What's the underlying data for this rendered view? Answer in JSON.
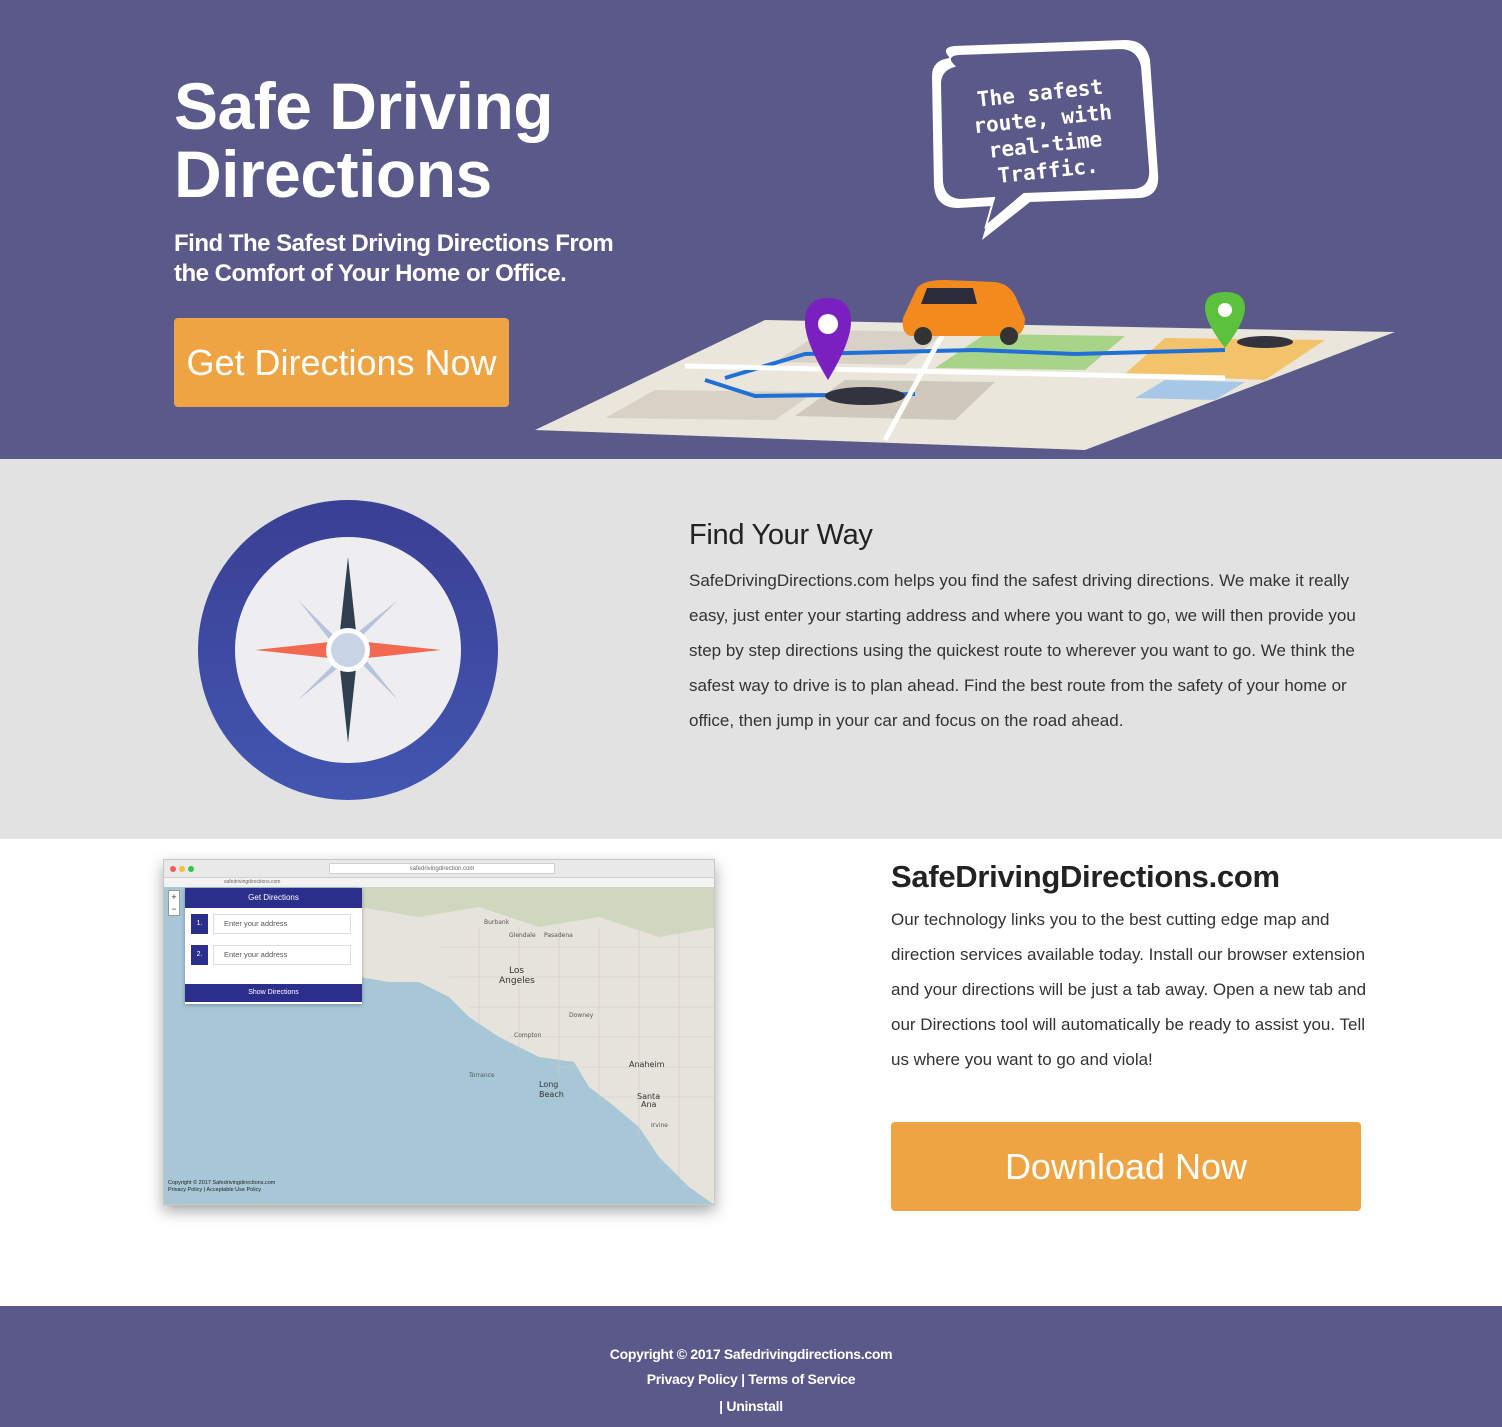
{
  "hero": {
    "title": "Safe Driving Directions",
    "subtitle": "Find The Safest Driving Directions From the Comfort of Your Home or Office.",
    "cta_label": "Get Directions Now",
    "bubble_text": "The safest route, with real-time Traffic."
  },
  "find_way": {
    "title": "Find Your Way",
    "body": "SafeDrivingDirections.com helps you find the safest driving directions. We make it really easy, just enter your starting address and where you want to go, we will then provide you step by step directions using the quickest route to wherever you want to go. We think the safest way to drive is to plan ahead. Find the best route from the safety of your home or office, then jump in your car and focus on the road ahead."
  },
  "product": {
    "title": "SafeDrivingDirections.com",
    "body": "Our technology links you to the best cutting edge map and direction services available today. Install our browser extension and your directions will be just a tab away. Open a new tab and our Directions tool will automatically be ready to assist you. Tell us where you want to go and viola!",
    "download_label": "Download Now",
    "screenshot": {
      "url": "safedrivingdirection.com",
      "tab": "safedrivingdirections.com",
      "panel_title": "Get Directions",
      "fields": [
        {
          "num": "1.",
          "placeholder": "Enter your address"
        },
        {
          "num": "2.",
          "placeholder": "Enter your address"
        }
      ],
      "show_button": "Show Directions",
      "map_labels": [
        "Burbank",
        "Glendale",
        "Pasadena",
        "Los Angeles",
        "Long Beach",
        "Anaheim",
        "Santa Ana",
        "Irvine",
        "Torrance",
        "Compton",
        "Downey"
      ],
      "copyright": "Copyright © 2017 Safedrivingdirections.com",
      "policy": "Privacy Policy | Acceptable Use Policy"
    }
  },
  "footer": {
    "copyright": "Copyright © 2017 Safedrivingdirections.com",
    "privacy": "Privacy Policy",
    "separator": "|",
    "terms": "Terms of Service",
    "uninstall_prefix": "|",
    "uninstall": "Uninstall"
  },
  "colors": {
    "brand_purple": "#5b5989",
    "accent_orange": "#eea443",
    "section_gray": "#e2e2e2",
    "compass_ring": "#3b46a0"
  }
}
